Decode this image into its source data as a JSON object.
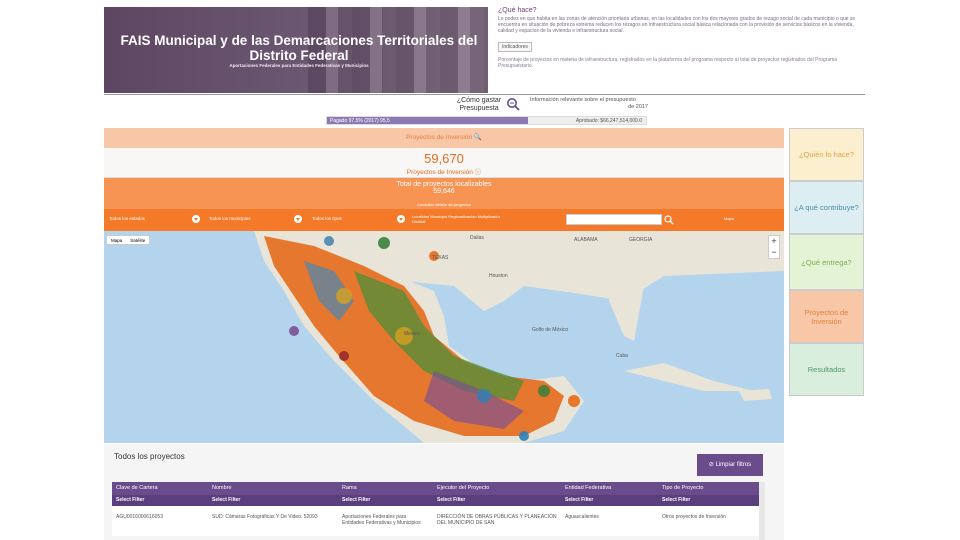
{
  "banner": {
    "title": "FAIS Municipal y de las Demarcaciones Territoriales del Distrito Federal",
    "subtitle": "Aportaciones Federales para Entidades Federativas y Municipios"
  },
  "description": {
    "title": "¿Qué hace?",
    "body": "Lo podes en que habita en las zonas de atención prioritaria urbanas, en las localidades con los dos mayores grados de rezago social de cada municipio o que se encuentra en situación de pobreza extrema reducen los rezagos en infraestructura social básica relacionada con la provisión de servicios básicos en la vivienda, calidad y espacios de la vivienda e infraestructura social.",
    "indicators_button": "Indicadores",
    "extra": "Porcentaje de proyectos en materia de infraestructura, registrados en la plataforma del programa respecto al total de proyectos registrados del Programa Presupuestario."
  },
  "budget": {
    "how_label": "¿Cómo gastar Presupuesta",
    "info": "Información relevante sobre el presupuesto",
    "year": "de 2017",
    "bar_label": "Pagado 97.5% (2017) 95,5",
    "approved": "Aprobado: $66,247,514,000.0",
    "paid_fraction": 0.63
  },
  "projects": {
    "header": "Proyectos de Inversión",
    "count": "59,670",
    "count_label": "Proyectos de Inversión",
    "total_label": "Total de proyectos localizables",
    "total_count": "59,646",
    "consult": "Consultar detalle de proyectos"
  },
  "filters": {
    "f1": "Todos los estados",
    "f2": "Todos los municipios",
    "f3": "Todos los tipos",
    "legend": "Localidad Municipio Regionalización Multiplicador Distrital",
    "map_label": "Mapa"
  },
  "map": {
    "type_map": "Mapa",
    "type_sat": "Satélite",
    "zoom_in": "+",
    "zoom_out": "−",
    "labels": {
      "texas": "TEXAS",
      "dallas": "Dallas",
      "houston": "Houston",
      "georgia": "GEORGIA",
      "gulf": "Golfo de México",
      "cuba": "Cuba",
      "mexico": "México",
      "alabama": "ALABAMA"
    }
  },
  "table": {
    "title": "Todos los proyectos",
    "clear_button": "Limpiar filtros",
    "columns": [
      "Clave de Cartera",
      "Nombre",
      "Rama",
      "Ejecutor del Proyecto",
      "Entidad Federativa",
      "Tipo de Proyecto"
    ],
    "select_label": "Select Filter",
    "row": [
      "AGU0016000616053",
      "SUD: Cámaras Fotográficas Y De Video. 52093",
      "Aportaciones Federales para Entidades Federativas y Municipios",
      "DIRECCIÓN DE OBRAS PÚBLICAS Y PLANEACIÓN DEL MUNICIPIO DE SAN",
      "Aguascalientes",
      "Otros proyectos de Inversión"
    ]
  },
  "sidenav": {
    "who": "¿Quién lo hace?",
    "contrib": "¿A qué contribuye?",
    "delivers": "¿Qué entrega?",
    "projects": "Proyectos de Inversión",
    "results": "Resultados"
  }
}
